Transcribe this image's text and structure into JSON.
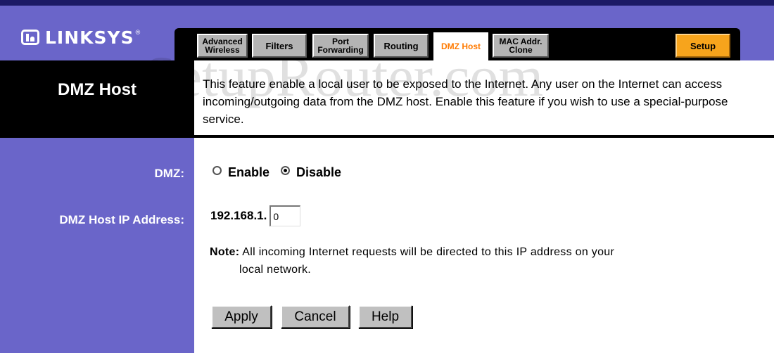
{
  "brand": {
    "name": "LINKSYS",
    "reg": "®"
  },
  "tabs": [
    {
      "id": "advanced-wireless",
      "label": "Advanced\nWireless"
    },
    {
      "id": "filters",
      "label": "Filters"
    },
    {
      "id": "port-forwarding",
      "label": "Port\nForwarding"
    },
    {
      "id": "routing",
      "label": "Routing"
    },
    {
      "id": "dmz-host",
      "label": "DMZ Host",
      "active": true
    },
    {
      "id": "mac-addr-clone",
      "label": "MAC Addr.\nClone"
    },
    {
      "id": "setup",
      "label": "Setup"
    }
  ],
  "header": {
    "title": "DMZ Host",
    "description": "This feature enable a local user to be exposed to the Internet. Any user on the Internet can access incoming/outgoing data from the DMZ host. Enable this feature if you wish to use a special-purpose service.",
    "watermark": "SetupRouter.com"
  },
  "dmz": {
    "label": "DMZ:",
    "enable_label": "Enable",
    "disable_label": "Disable",
    "selected": "disable"
  },
  "ip": {
    "label": "DMZ Host IP Address:",
    "prefix": "192.168.1.",
    "value": "0"
  },
  "note": {
    "label": "Note:",
    "line1": "All incoming Internet requests will be directed to this IP address on your",
    "line2": "local network."
  },
  "buttons": {
    "apply": "Apply",
    "cancel": "Cancel",
    "help": "Help"
  },
  "colors": {
    "sidebar": "#6a65c9",
    "active_tab_text": "#ff7a00",
    "setup_tab": "#f7a41c"
  }
}
